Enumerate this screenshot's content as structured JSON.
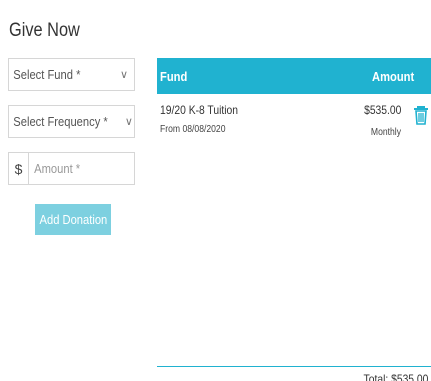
{
  "page": {
    "title": "Give Now"
  },
  "form": {
    "fund_placeholder": "Select Fund *",
    "frequency_placeholder": "Select Frequency *",
    "currency_symbol": "$",
    "amount_placeholder": "Amount *",
    "add_button_label": "Add Donation",
    "add_button_color": "#7dd0e0"
  },
  "table": {
    "header_color": "#20b2d0",
    "headers": {
      "fund": "Fund",
      "amount": "Amount"
    },
    "rows": [
      {
        "fund": "19/20 K-8 Tuition",
        "from": "From 08/08/2020",
        "amount": "$535.00",
        "frequency": "Monthly",
        "action_icon": "trash-icon"
      }
    ],
    "total": "Total: $535.00"
  }
}
